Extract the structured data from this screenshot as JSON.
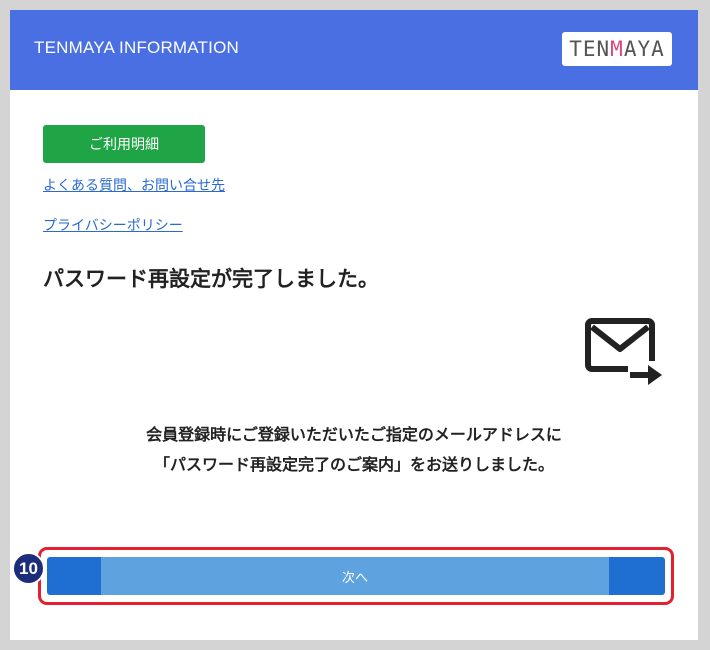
{
  "header": {
    "title": "TENMAYA INFORMATION",
    "logo_prefix": "TEN",
    "logo_accent": "M",
    "logo_suffix": "AYA"
  },
  "nav": {
    "usage_details_label": "ご利用明細",
    "faq_link": "よくある質問、お問い合せ先",
    "privacy_link": "プライバシーポリシー"
  },
  "main": {
    "heading": "パスワード再設定が完了しました。",
    "message_line1": "会員登録時にご登録いただいたご指定のメールアドレスに",
    "message_line2": "「パスワード再設定完了のご案内」をお送りしました。",
    "mail_icon": "mail-send-icon"
  },
  "actions": {
    "next_label": "次へ"
  },
  "annotation": {
    "step_number": "10"
  },
  "colors": {
    "header_bg": "#4a6fe3",
    "primary_green": "#1fa546",
    "link_blue": "#2a6ad1",
    "button_blue": "#1e6fd1",
    "highlight_red": "#e3202f",
    "badge_navy": "#1c2d7a",
    "logo_accent": "#e0457b"
  }
}
